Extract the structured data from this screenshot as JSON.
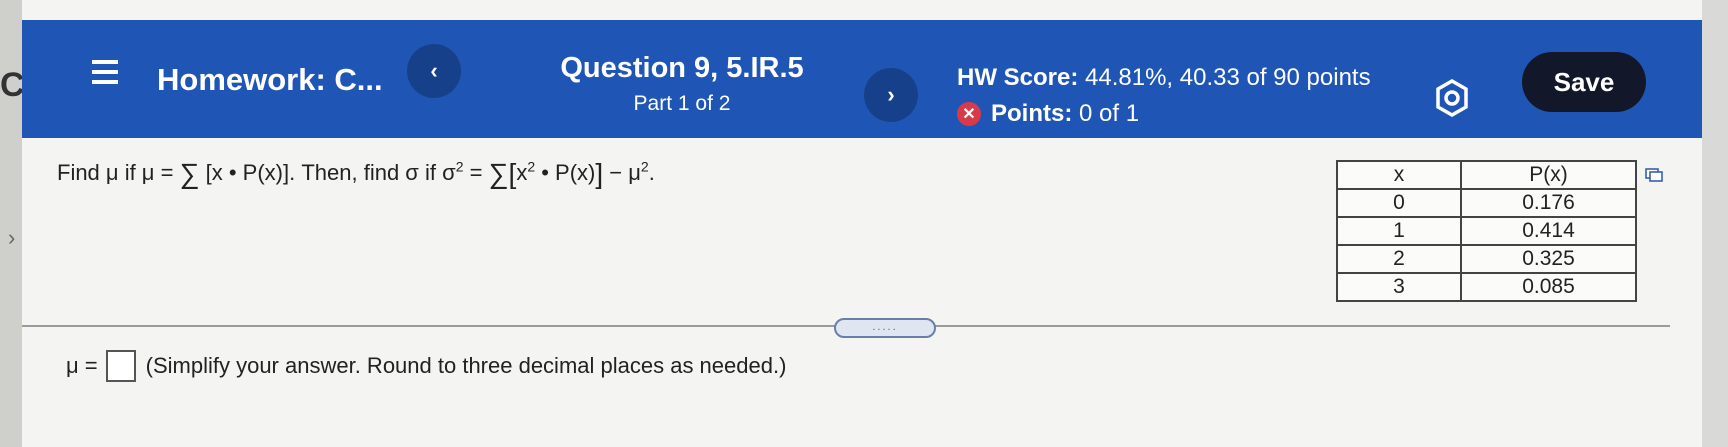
{
  "left_edge": {
    "glyph": "C",
    "chevron": "›"
  },
  "header": {
    "title": "Homework: C...",
    "prev_label": "‹",
    "next_label": "›",
    "question_title": "Question 9, 5.IR.5",
    "question_part": "Part 1 of 2",
    "hw_score_label": "HW Score:",
    "hw_score_value": "44.81%, 40.33 of 90 points",
    "points_label": "Points:",
    "points_value": "0 of 1",
    "save_label": "Save"
  },
  "question": {
    "prefix": "Find μ if μ = ",
    "mid1": " [x • P(x)]. Then, find σ if σ",
    "sup2": "2",
    "mid2": " = ",
    "x_term": "x",
    "mid3": " • P(x)",
    "mid4": " − μ",
    "end": "."
  },
  "table": {
    "headers": [
      "x",
      "P(x)"
    ],
    "rows": [
      [
        "0",
        "0.176"
      ],
      [
        "1",
        "0.414"
      ],
      [
        "2",
        "0.325"
      ],
      [
        "3",
        "0.085"
      ]
    ]
  },
  "handle_label": ".....",
  "answer": {
    "label": "μ =",
    "hint": "(Simplify your answer. Round to three decimal places as needed.)"
  },
  "colors": {
    "header": "#1f56b5",
    "save": "#121829",
    "incorrect": "#d93a4a"
  }
}
